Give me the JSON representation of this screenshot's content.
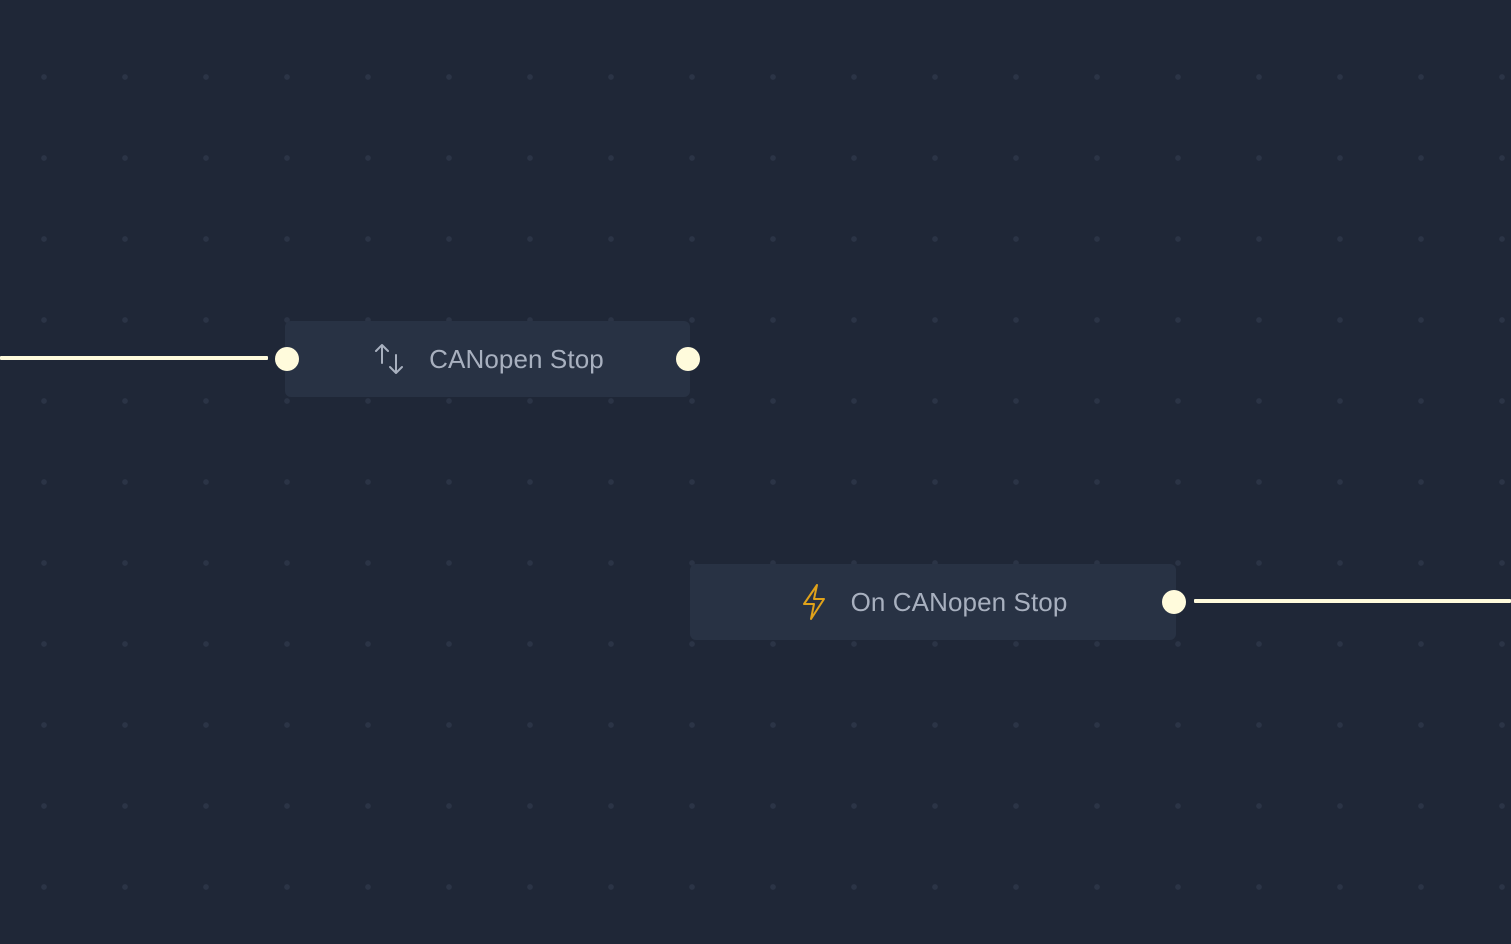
{
  "canvas": {
    "background": "#1f2737",
    "grid_dot_color": "#2b3446"
  },
  "colors": {
    "node_bg": "#283244",
    "label": "#a8b0bf",
    "wire": "#fffbdc",
    "port": "#fffbdc",
    "event_icon": "#e0a21a",
    "action_icon": "#a8b0bf"
  },
  "nodes": [
    {
      "id": "canopen-stop",
      "label": "CANopen Stop",
      "icon": "arrows-up-down-icon",
      "ports": [
        "input",
        "output"
      ]
    },
    {
      "id": "on-canopen-stop",
      "label": "On CANopen Stop",
      "icon": "lightning-bolt-icon",
      "ports": [
        "output"
      ]
    }
  ]
}
